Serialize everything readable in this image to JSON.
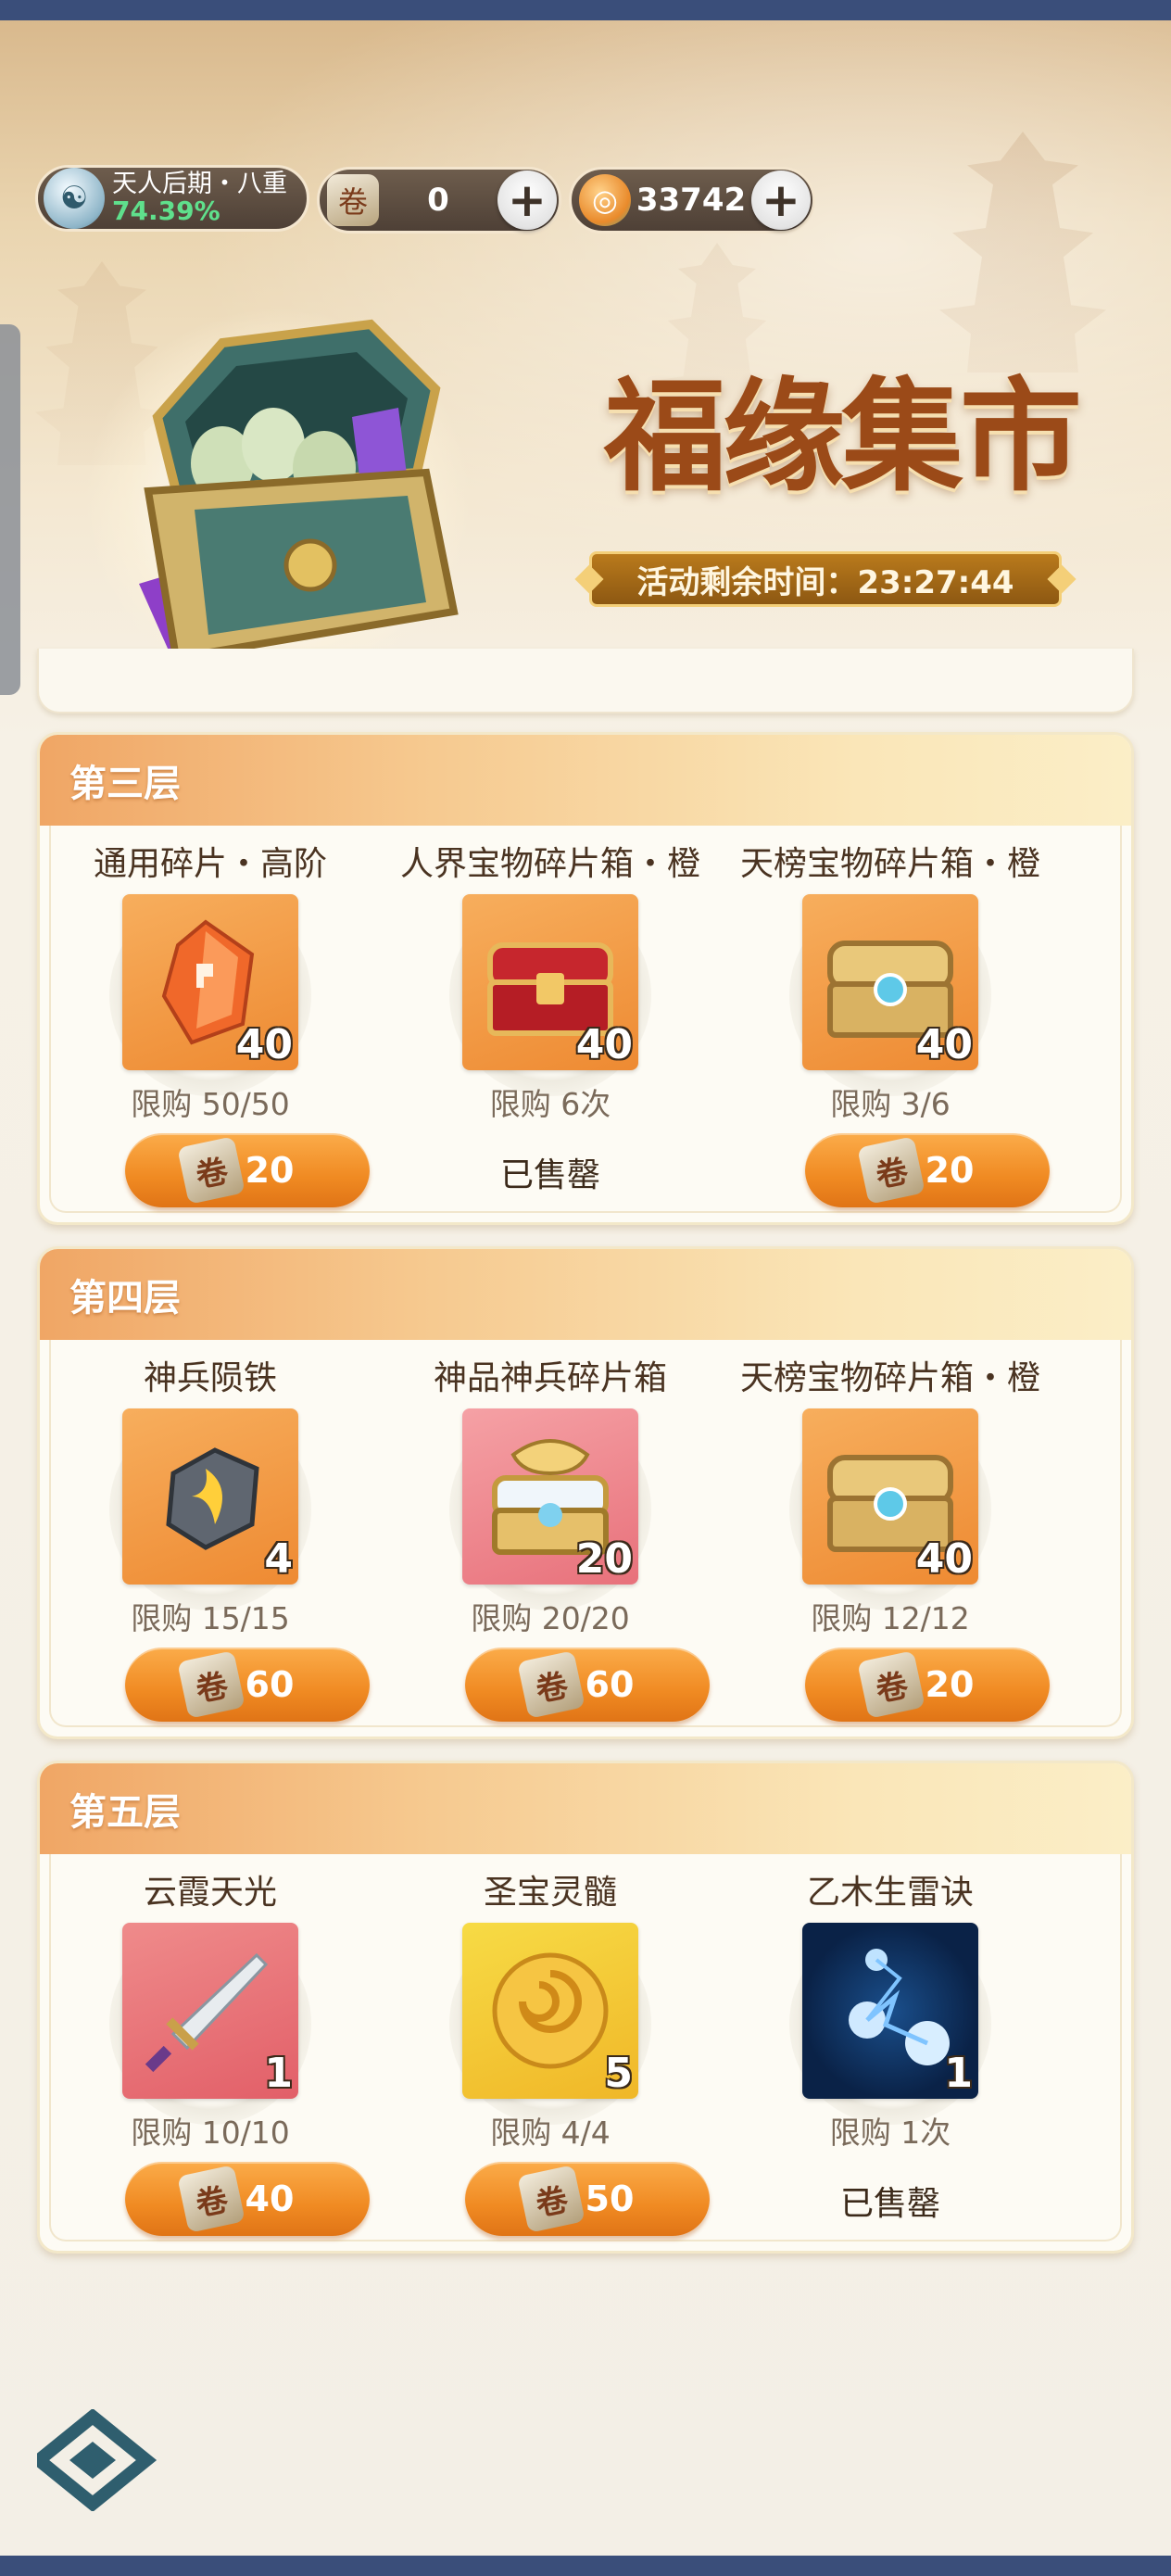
{
  "header": {
    "rank_title": "天人后期・八重",
    "rank_progress": "74.39%",
    "currency1_value": "0",
    "currency2_value": "33742",
    "title": "福缘集市",
    "timer": "活动剩余时间：23:27:44"
  },
  "tiers": [
    {
      "title": "第三层",
      "items": [
        {
          "name": "通用碎片・高阶",
          "count": "40",
          "limit": "限购 50/50",
          "price": "20",
          "sold_out": ""
        },
        {
          "name": "人界宝物碎片箱・橙",
          "count": "40",
          "limit": "限购 6次",
          "price": "",
          "sold_out": "已售罄"
        },
        {
          "name": "天榜宝物碎片箱・橙",
          "count": "40",
          "limit": "限购 3/6",
          "price": "20",
          "sold_out": ""
        }
      ]
    },
    {
      "title": "第四层",
      "items": [
        {
          "name": "神兵陨铁",
          "count": "4",
          "limit": "限购 15/15",
          "price": "60",
          "sold_out": ""
        },
        {
          "name": "神品神兵碎片箱",
          "count": "20",
          "limit": "限购 20/20",
          "price": "60",
          "sold_out": ""
        },
        {
          "name": "天榜宝物碎片箱・橙",
          "count": "40",
          "limit": "限购 12/12",
          "price": "20",
          "sold_out": ""
        }
      ]
    },
    {
      "title": "第五层",
      "items": [
        {
          "name": "云霞天光",
          "count": "1",
          "limit": "限购 10/10",
          "price": "40",
          "sold_out": ""
        },
        {
          "name": "圣宝灵髓",
          "count": "5",
          "limit": "限购 4/4",
          "price": "50",
          "sold_out": ""
        },
        {
          "name": "乙木生雷诀",
          "count": "1",
          "limit": "限购 1次",
          "price": "",
          "sold_out": "已售罄"
        }
      ]
    }
  ],
  "icons": {
    "rank": "cultivator-avatar-icon",
    "currency1": "scroll-token-icon",
    "currency2": "jade-coin-icon",
    "plus": "plus-icon",
    "button_coin": "scroll-token-icon",
    "logo": "game-logo-icon"
  },
  "colors": {
    "accent_orange": "#f08a22",
    "tier_header": "#f0a665",
    "title_brown": "#9b4a18",
    "progress_green": "#5fe08c"
  }
}
